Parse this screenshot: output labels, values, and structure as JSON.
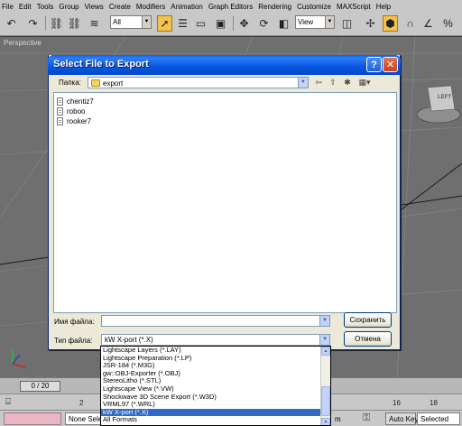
{
  "menubar": {
    "items": [
      "File",
      "Edit",
      "Tools",
      "Group",
      "Views",
      "Create",
      "Modifiers",
      "Animation",
      "Graph Editors",
      "Rendering",
      "Customize",
      "MAXScript",
      "Help"
    ]
  },
  "toolbar": {
    "filter_value": "All",
    "refcoord_value": "View"
  },
  "viewport": {
    "label": "Perspective",
    "viewcube_label": "LEFT"
  },
  "dialog": {
    "title": "Select File to Export",
    "lookin_label": "Папка:",
    "lookin_value": "export",
    "files": [
      "chentiz7",
      "roboo",
      "rooker7"
    ],
    "filename_label": "Имя файла:",
    "filename_value": "",
    "filetype_label": "Тип файла:",
    "filetype_value": "kW X-port (*.X)",
    "save_label": "Сохранить",
    "cancel_label": "Отмена"
  },
  "filetype_options": [
    "Lightscape Layers (*.LAY)",
    "Lightscape Preparation (*.LP)",
    "JSR-184 (*.M3G)",
    "gw::OBJ-Exporter (*.OBJ)",
    "StereoLitho (*.STL)",
    "Lightscape View (*.VW)",
    "Shockwave 3D Scene Export (*.W3D)",
    "VRML97 (*.WRL)",
    "kW X-port (*.X)",
    "All Formats"
  ],
  "filetype_selected_index": 8,
  "timeline": {
    "frame_display": "0 / 20",
    "ruler_ticks": [
      "2",
      "16",
      "18"
    ]
  },
  "statusbar": {
    "selection_text": "None Selec",
    "unit_fragment": "m",
    "autokey_label": "Auto Key",
    "selected_dropdown": "Selected"
  }
}
